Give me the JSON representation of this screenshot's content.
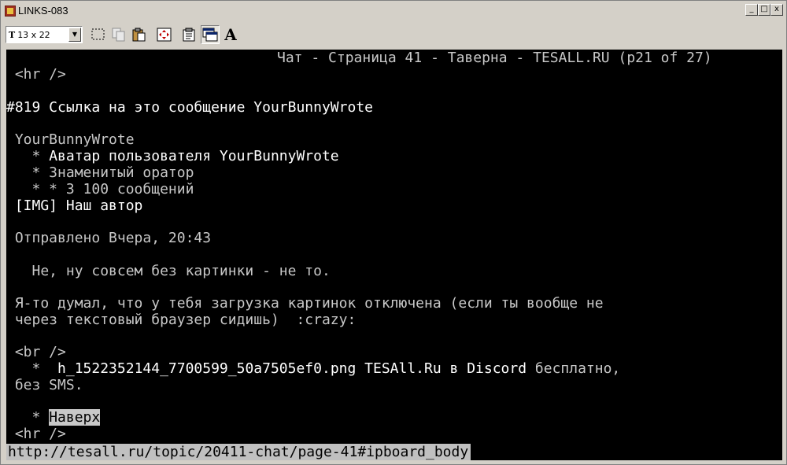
{
  "window": {
    "title": "LINKS-083"
  },
  "window_controls": {
    "minimize": "_",
    "maximize": "□",
    "close": "x"
  },
  "toolbar": {
    "font_selector_icon": "T",
    "font_selector_value": "13 x 22",
    "buttons": [
      "select-rect-icon",
      "copy-icon",
      "paste-icon",
      "fit-icon",
      "properties-icon",
      "window-icon",
      "font-icon"
    ],
    "font_button_label": "A"
  },
  "terminal": {
    "header": "Чат - Страница 41 - Таверна - TESALL.RU (p21 of 27)",
    "hr1": " <hr />",
    "post_heading": "#819 Ссылка на это сообщение YourBunnyWrote",
    "author": " YourBunnyWrote",
    "bullet1_prefix": "   * ",
    "bullet1_text": "Аватар пользователя YourBunnyWrote",
    "bullet2": "   * Знаменитый оратор",
    "bullet3": "   * * 3 100 сообщений",
    "img_line": " [IMG] Наш автор",
    "sent": " Отправлено Вчера, 20:43",
    "msg1": "   Не, ну совсем без картинки - не то.",
    "msg2": " Я-то думал, что у тебя загрузка картинок отключена (если ты вообще не",
    "msg3": " через текстовый браузер сидишь)  :crazy:",
    "br": " <br />",
    "link_prefix": "   *  ",
    "link_text": "h_1522352144_7700599_50a7505ef0.png TESAll.Ru в Discord",
    "link_suffix": " бесплатно,",
    "link_cont": " без SMS.",
    "top_prefix": "   * ",
    "top_link": "Наверх",
    "hr2": " <hr />"
  },
  "status_url": "http://tesall.ru/topic/20411-chat/page-41#ipboard_body"
}
